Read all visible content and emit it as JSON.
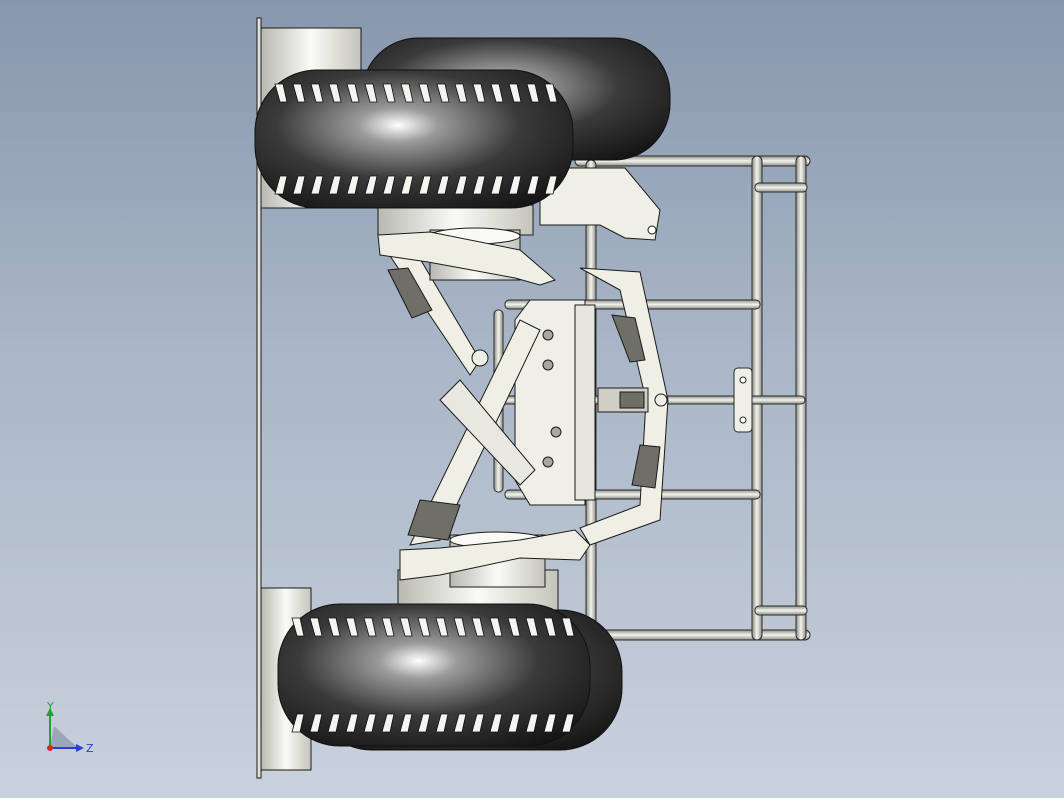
{
  "viewport": {
    "background_top": "#8797ad",
    "background_bottom": "#c9d1dc"
  },
  "model": {
    "part_color": "#f0efe6",
    "edge_color": "#1a1a1a",
    "tire_color": "#3b3b3b",
    "tire_highlight": "#e8eaea",
    "panel_color": "#d8d8d2",
    "panel_dark": "#6f6f68"
  },
  "triad": {
    "y_label": "Y",
    "z_label": "Z",
    "y_color": "#21a32a",
    "z_color": "#2a3fd6",
    "x_color": "#d42a2a"
  }
}
